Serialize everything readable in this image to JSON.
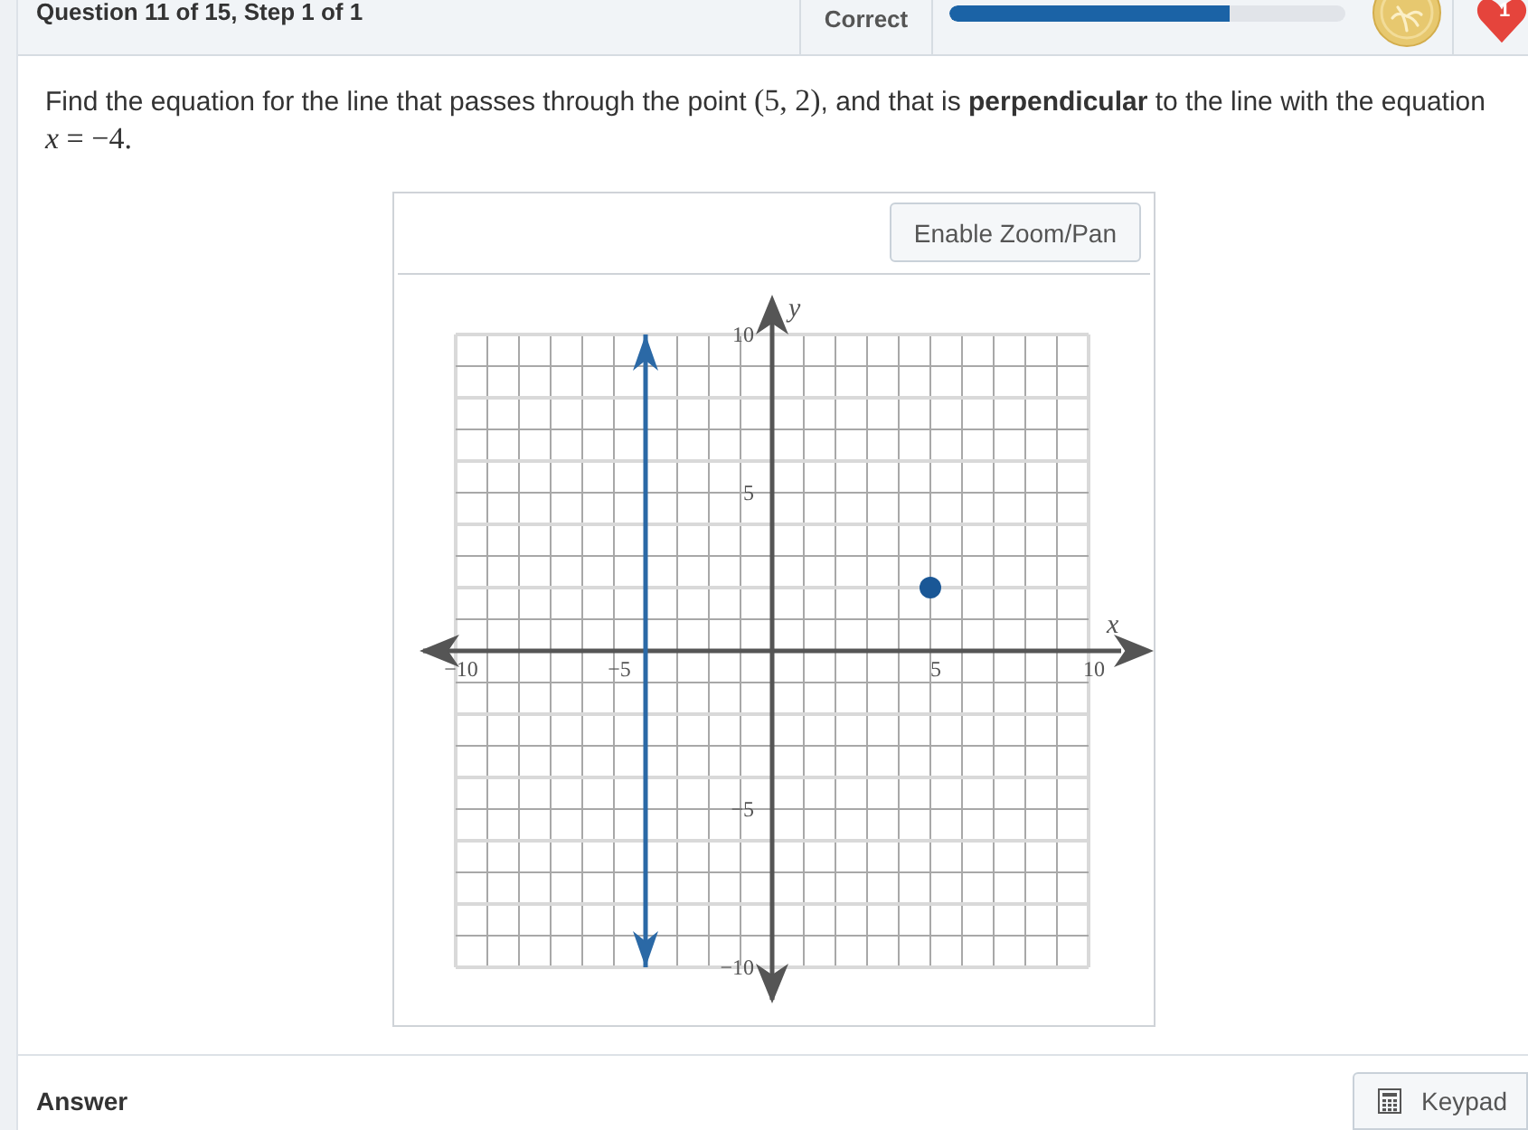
{
  "header": {
    "title": "Question 11 of 15, Step 1 of 1",
    "status": "Correct",
    "progress": {
      "level": 0.71
    },
    "lives": "1"
  },
  "question": [
    {
      "kind": "text",
      "text": "Find the equation for the line that passes through the point "
    },
    {
      "kind": "math",
      "text": "(5, 2)"
    },
    {
      "kind": "text",
      "text": ", and that is **perpendicular** to the line with the equation "
    },
    {
      "kind": "math",
      "text": "*x* = −4."
    }
  ],
  "graph": {
    "zoom_button": "Enable Zoom/Pan",
    "chart_data": {
      "type": "scatter",
      "xlabel": "x",
      "ylabel": "y",
      "xlim": [
        -10,
        10
      ],
      "ylim": [
        -10,
        10
      ],
      "grid": true,
      "xticks": [
        {
          "value": -10,
          "label": "−10"
        },
        {
          "value": -5,
          "label": "−5"
        },
        5,
        10
      ],
      "yticks": [
        {
          "value": -10,
          "label": "−10"
        },
        {
          "value": -5,
          "label": "−5"
        },
        5,
        10
      ],
      "x": [
        5
      ],
      "series": [
        {
          "color": "#1a5796",
          "values": [
            2
          ]
        }
      ],
      "ref_lines": [
        {
          "axis": "x",
          "value": -4,
          "color": "#2b69a6"
        }
      ]
    }
  },
  "answer": {
    "label": "Answer",
    "keypad_button": "Keypad"
  }
}
